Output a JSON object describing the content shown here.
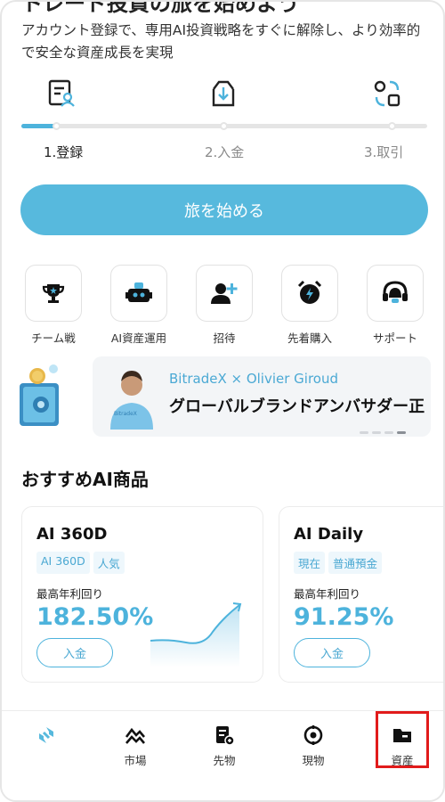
{
  "header": {
    "cut_title": "トレード投資の旅を始めよう",
    "description": "アカウント登録で、専用AI投資戦略をすぐに解除し、より効率的で安全な資産成長を実現"
  },
  "steps": [
    {
      "label": "1.登録",
      "icon": "register-icon"
    },
    {
      "label": "2.入金",
      "icon": "deposit-icon"
    },
    {
      "label": "3.取引",
      "icon": "trade-icon"
    }
  ],
  "progress": {
    "current_step": 1,
    "total_steps": 3
  },
  "cta": {
    "label": "旅を始める"
  },
  "quick_actions": [
    {
      "label": "チーム戦",
      "icon": "trophy-icon"
    },
    {
      "label": "AI資産運用",
      "icon": "robot-icon"
    },
    {
      "label": "招待",
      "icon": "invite-user-icon"
    },
    {
      "label": "先着購入",
      "icon": "alarm-clock-icon"
    },
    {
      "label": "サポート",
      "icon": "headset-icon"
    }
  ],
  "banner": {
    "brand": "BitradeX × Olivier Giroud",
    "subtitle": "グローバルブランドアンバサダー正",
    "shirt_text": "BitradeX",
    "active_dot": 4,
    "dots": 4
  },
  "products": {
    "section_title": "おすすめAI商品",
    "items": [
      {
        "name": "AI 360D",
        "tags": [
          "AI 360D",
          "人気"
        ],
        "yield_label": "最高年利回り",
        "yield": "182.50%",
        "button": "入金"
      },
      {
        "name": "AI Daily",
        "tags": [
          "現在",
          "普通預金"
        ],
        "yield_label": "最高年利回り",
        "yield": "91.25%",
        "button": "入金"
      }
    ]
  },
  "tabbar": {
    "items": [
      {
        "label": "",
        "icon": "home-logo-icon"
      },
      {
        "label": "市場",
        "icon": "market-icon"
      },
      {
        "label": "先物",
        "icon": "futures-icon"
      },
      {
        "label": "現物",
        "icon": "spot-icon"
      },
      {
        "label": "資産",
        "icon": "assets-icon"
      }
    ]
  },
  "colors": {
    "accent": "#57b9dd",
    "highlight": "#e11b1b"
  }
}
